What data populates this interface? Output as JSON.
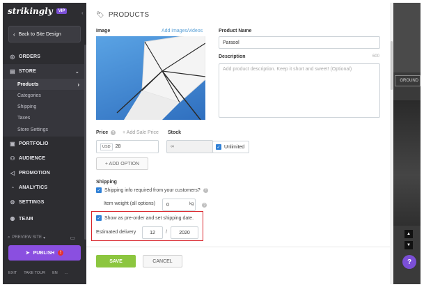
{
  "sidebar": {
    "logo": "strikingly",
    "vip_badge": "VIP",
    "back_label": "Back to Site Design",
    "items": [
      {
        "label": "ORDERS",
        "icon": "orders-icon"
      },
      {
        "label": "STORE",
        "icon": "store-icon"
      },
      {
        "label": "PORTFOLIO",
        "icon": "portfolio-icon"
      },
      {
        "label": "AUDIENCE",
        "icon": "audience-icon"
      },
      {
        "label": "PROMOTION",
        "icon": "promotion-icon"
      },
      {
        "label": "ANALYTICS",
        "icon": "analytics-icon"
      },
      {
        "label": "SETTINGS",
        "icon": "settings-icon"
      },
      {
        "label": "TEAM",
        "icon": "team-icon"
      }
    ],
    "store_sub": [
      "Products",
      "Categories",
      "Shipping",
      "Taxes",
      "Store Settings"
    ],
    "preview_site": "PREVIEW SITE",
    "publish_label": "PUBLISH",
    "publish_badge": "!",
    "footer": [
      "EXIT",
      "TAKE TOUR",
      "EN",
      "..."
    ]
  },
  "main": {
    "title": "PRODUCTS",
    "image_label": "Image",
    "add_images_link": "Add images/videos",
    "product_name_label": "Product Name",
    "product_name_value": "Parasol",
    "description_label": "Description",
    "description_count": "600",
    "description_placeholder": "Add product description. Keep it short and sweet! (Optional)",
    "price_label": "Price",
    "add_sale_price": "+ Add Sale Price",
    "stock_label": "Stock",
    "currency": "USD",
    "price_value": "28",
    "stock_value": "∞",
    "unlimited_label": "Unlimited",
    "add_option_label": "+ ADD OPTION",
    "shipping_label": "Shipping",
    "shipping_info_label": "Shipping info required from your customers?",
    "item_weight_label": "Item weight (all options)",
    "weight_value": "0",
    "weight_unit": "kg",
    "preorder_label": "Show as pre-order and set shipping date.",
    "estimated_delivery_label": "Estimated delivery",
    "delivery_month": "12",
    "delivery_separator": "/",
    "delivery_year": "2020",
    "save_label": "SAVE",
    "cancel_label": "CANCEL"
  },
  "preview": {
    "bg_word": "GROUND"
  },
  "colors": {
    "sidebar_bg": "#2d2d31",
    "publish": "#8a4fe0",
    "save": "#8cc63f",
    "link": "#5aa0d6",
    "highlight": "#d9252b",
    "checkbox": "#2f80d6"
  }
}
